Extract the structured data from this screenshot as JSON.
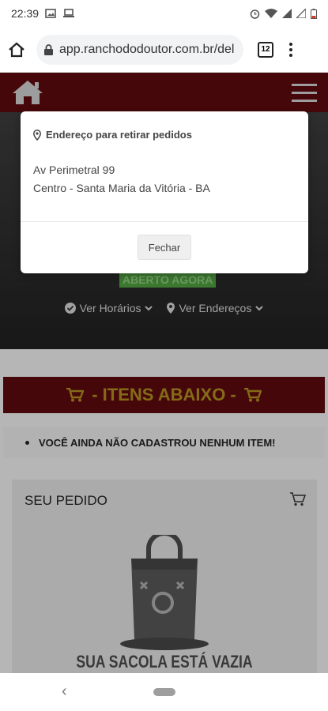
{
  "status_bar": {
    "time": "22:39"
  },
  "browser": {
    "url": "app.ranchododoutor.com.br/del",
    "tab_count": "12"
  },
  "hero": {
    "open_badge": "ABERTO AGORA",
    "hours_link": "Ver Horários",
    "addresses_link": "Ver Endereços"
  },
  "items_banner": {
    "label": "- ITENS ABAIXO -"
  },
  "empty_items": {
    "message": "VOCÊ AINDA NÃO CADASTROU NENHUM ITEM!"
  },
  "order": {
    "title": "SEU PEDIDO",
    "empty_bag": "SUA SACOLA ESTÁ VAZIA"
  },
  "modal": {
    "title": "Endereço para retirar pedidos",
    "address_line1": "Av Perimetral 99",
    "address_line2": "Centro - Santa Maria da Vitória - BA",
    "close_label": "Fechar"
  },
  "colors": {
    "brand_dark_red": "#5a0a0d",
    "banner_text_gold": "#a98a1f",
    "badge_green": "#4e9a3e"
  }
}
